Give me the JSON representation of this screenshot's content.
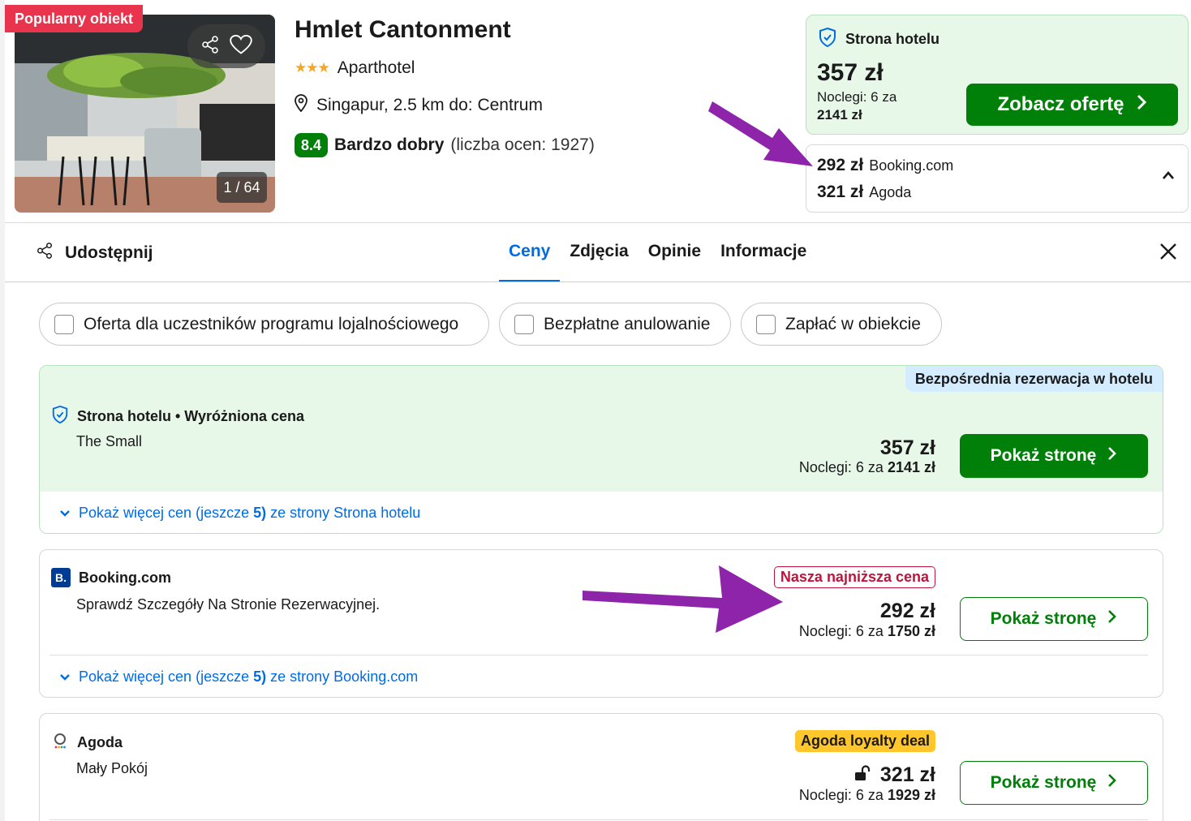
{
  "hotel": {
    "badge": "Popularny obiekt",
    "photo_counter": "1 / 64",
    "name": "Hmlet Cantonment",
    "stars": "★★★",
    "type": "Aparthotel",
    "location": "Singapur, 2.5 km do: Centrum",
    "rating_score": "8.4",
    "rating_label": "Bardzo dobry",
    "rating_count": "(liczba ocen: 1927)"
  },
  "top_offer": {
    "title": "Strona hotelu",
    "price": "357 zł",
    "nights_label": "Noclegi: 6 za",
    "nights_total": "2141 zł",
    "cta": "Zobacz ofertę"
  },
  "alt_prices": [
    {
      "price": "292 zł",
      "source": "Booking.com"
    },
    {
      "price": "321 zł",
      "source": "Agoda"
    }
  ],
  "tabs_bar": {
    "share": "Udostępnij",
    "tabs": [
      "Ceny",
      "Zdjęcia",
      "Opinie",
      "Informacje"
    ],
    "active_tab": "Ceny"
  },
  "filters": [
    "Oferta dla uczestników programu lojalnościowego",
    "Bezpłatne anulowanie",
    "Zapłać w obiekcie"
  ],
  "offers": [
    {
      "tag": "Bezpośrednia rezerwacja w hotelu",
      "provider": "Strona hotelu • Wyróżniona cena",
      "room": "The Small",
      "price": "357 zł",
      "nights_label": "Noclegi: 6 za",
      "nights_total": "2141 zł",
      "cta": "Pokaż stronę",
      "more_prefix": "Pokaż więcej cen (jeszcze",
      "more_count": "5)",
      "more_suffix": "ze strony Strona hotelu"
    },
    {
      "badge": "Nasza najniższa cena",
      "provider": "Booking.com",
      "logo": "B.",
      "room": "Sprawdź Szczegóły Na Stronie Rezerwacyjnej.",
      "price": "292 zł",
      "nights_label": "Noclegi: 6 za",
      "nights_total": "1750 zł",
      "cta": "Pokaż stronę",
      "more_prefix": "Pokaż więcej cen (jeszcze",
      "more_count": "5)",
      "more_suffix": "ze strony Booking.com"
    },
    {
      "badge": "Agoda loyalty deal",
      "provider": "Agoda",
      "room": "Mały Pokój",
      "price": "321 zł",
      "nights_label": "Noclegi: 6 za",
      "nights_total": "1929 zł",
      "cta": "Pokaż stronę"
    }
  ],
  "colors": {
    "brand_green": "#008009",
    "link_blue": "#006ce4",
    "highlight_green_bg": "#e7f7e8",
    "popular_red": "#e8344d",
    "annotation_purple": "#8e24aa"
  }
}
